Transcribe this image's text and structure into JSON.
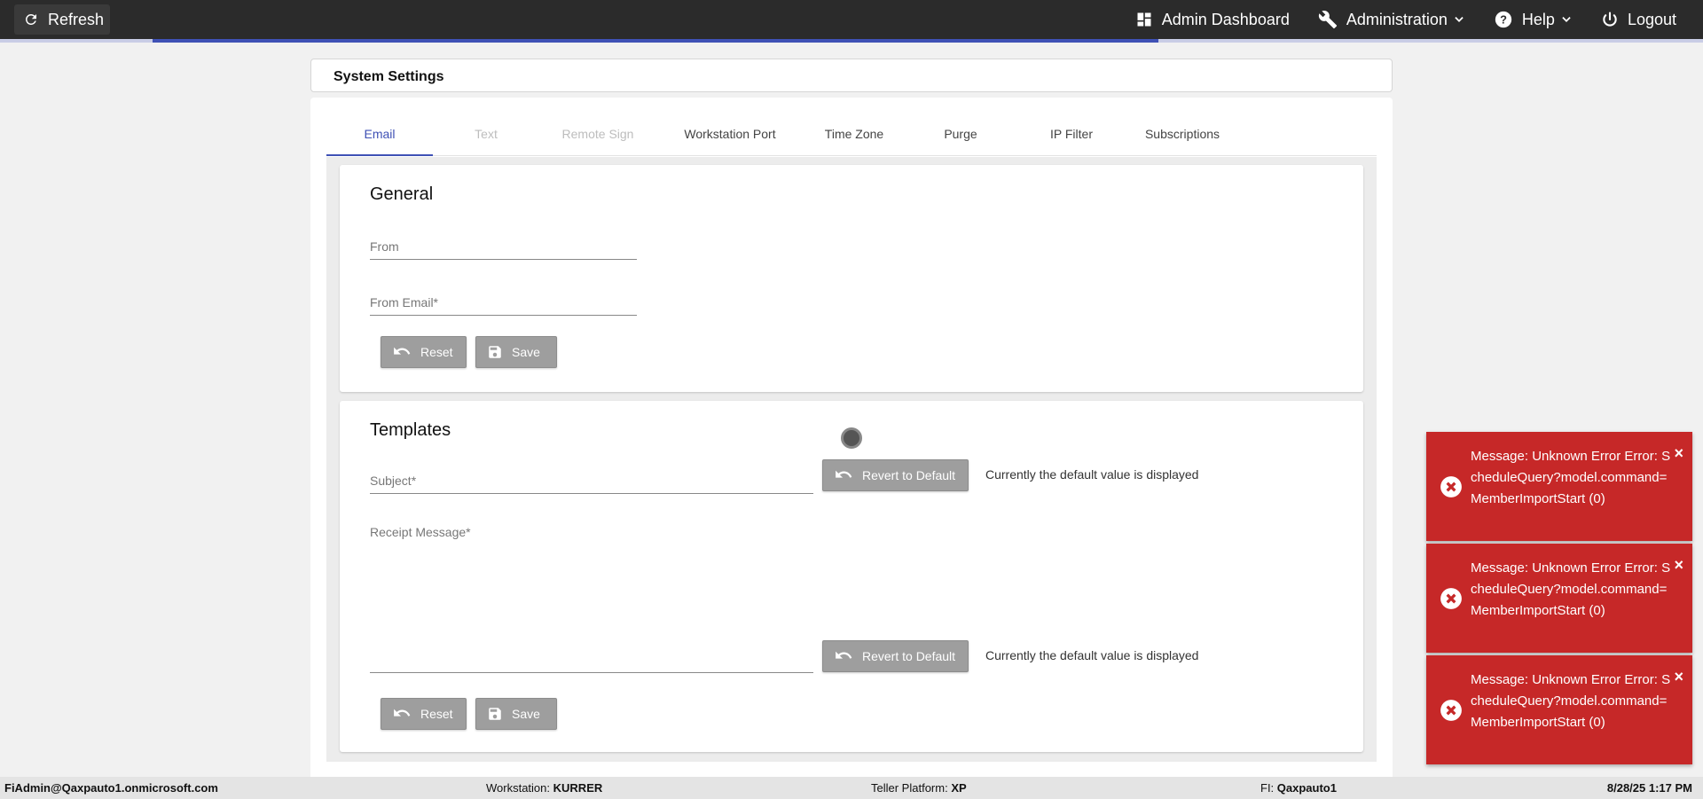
{
  "topbar": {
    "refresh_label": "Refresh",
    "nav": {
      "admin_dashboard": "Admin Dashboard",
      "administration": "Administration",
      "help": "Help",
      "logout": "Logout"
    }
  },
  "progress_fraction": 0.59,
  "page": {
    "title": "System Settings"
  },
  "tabs": [
    {
      "label": "Email",
      "state": "active"
    },
    {
      "label": "Text",
      "state": "disabled"
    },
    {
      "label": "Remote Sign",
      "state": "disabled"
    },
    {
      "label": "Workstation Port",
      "state": "normal"
    },
    {
      "label": "Time Zone",
      "state": "normal"
    },
    {
      "label": "Purge",
      "state": "normal"
    },
    {
      "label": "IP Filter",
      "state": "normal"
    },
    {
      "label": "Subscriptions",
      "state": "normal"
    }
  ],
  "general": {
    "title": "General",
    "from_label": "From",
    "from_value": "",
    "from_email_label": "From Email*",
    "from_email_value": "",
    "reset_label": "Reset",
    "save_label": "Save"
  },
  "templates": {
    "title": "Templates",
    "subject_label": "Subject*",
    "subject_value": "",
    "receipt_label": "Receipt Message*",
    "receipt_value": "",
    "revert_label": "Revert to Default",
    "default_note": "Currently the default value is displayed",
    "reset_label": "Reset",
    "save_label": "Save"
  },
  "toasts": [
    {
      "message": "Message: Unknown Error Error: ScheduleQuery?model.command=MemberImportStart (0)"
    },
    {
      "message": "Message: Unknown Error Error: ScheduleQuery?model.command=MemberImportStart (0)"
    },
    {
      "message": "Message: Unknown Error Error: ScheduleQuery?model.command=MemberImportStart (0)"
    }
  ],
  "toast_close": "×",
  "status": {
    "user": "FiAdmin@Qaxpauto1.onmicrosoft.com",
    "workstation_label": "Workstation:",
    "workstation_value": "KURRER",
    "platform_label": "Teller Platform:",
    "platform_value": "XP",
    "fi_label": "FI:",
    "fi_value": "Qaxpauto1",
    "datetime": "8/28/25 1:17 PM"
  },
  "colors": {
    "topbar": "#2b2b2b",
    "accent": "#3f51b5",
    "error": "#c62828",
    "button_grey": "#9e9e9e"
  }
}
